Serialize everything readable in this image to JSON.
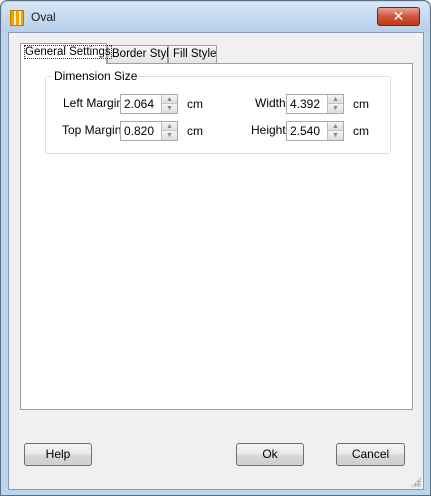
{
  "window": {
    "title": "Oval",
    "close_icon": "close-x-icon",
    "app_icon": "oval-app-icon"
  },
  "tabs": [
    {
      "label": "General Settings",
      "active": true
    },
    {
      "label": "Border Style",
      "active": false
    },
    {
      "label": "Fill Style",
      "active": false
    }
  ],
  "dimension": {
    "group_title": "Dimension Size",
    "left_margin": {
      "label": "Left Margin",
      "value": "2.064",
      "unit": "cm"
    },
    "top_margin": {
      "label": "Top Margin",
      "value": "0.820",
      "unit": "cm"
    },
    "width": {
      "label": "Width",
      "value": "4.392",
      "unit": "cm"
    },
    "height": {
      "label": "Height",
      "value": "2.540",
      "unit": "cm"
    }
  },
  "buttons": {
    "help": "Help",
    "ok": "Ok",
    "cancel": "Cancel"
  },
  "colors": {
    "close_button": "#c7432a",
    "title_bar": "#c5daf1"
  }
}
